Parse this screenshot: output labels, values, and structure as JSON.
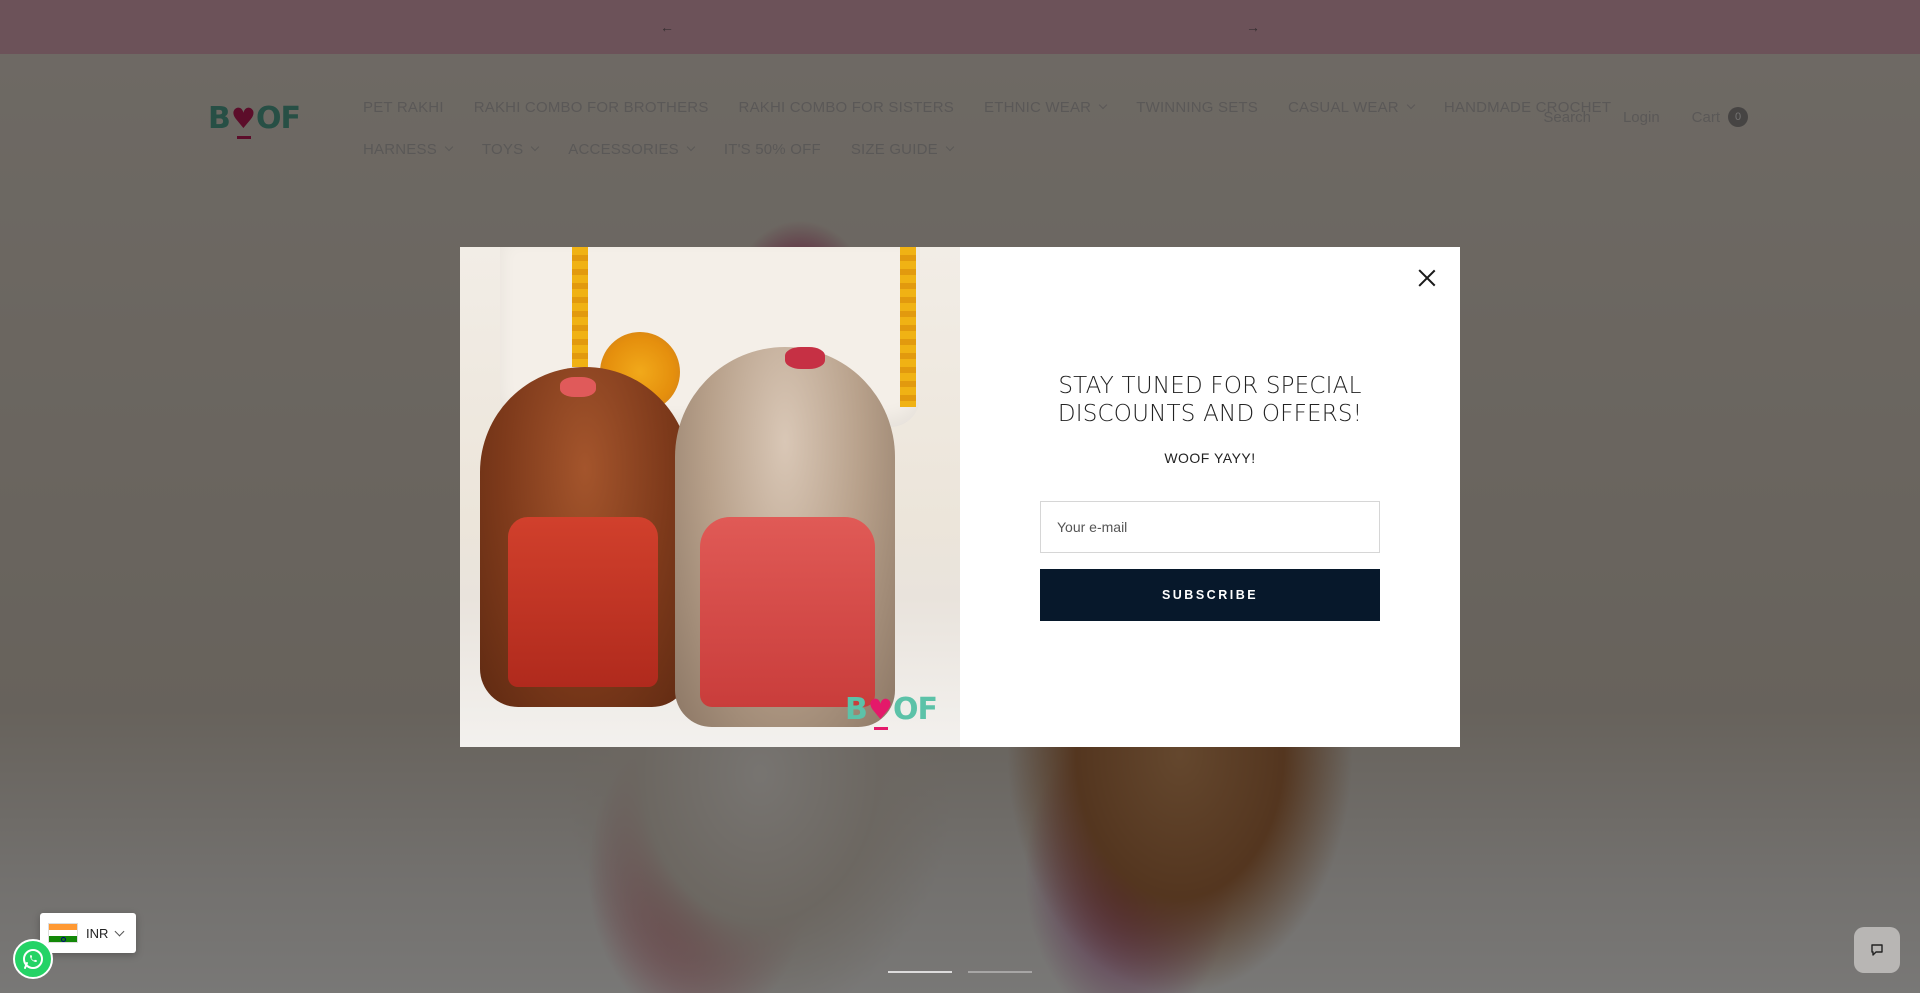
{
  "announcement": {
    "prev_icon": "arrow-left-icon",
    "next_icon": "arrow-right-icon"
  },
  "header": {
    "logo": {
      "part1": "B",
      "heart": "♥",
      "part2": "OF"
    },
    "nav_row1": [
      {
        "label": "PET RAKHI",
        "dropdown": false
      },
      {
        "label": "RAKHI COMBO FOR BROTHERS",
        "dropdown": false
      },
      {
        "label": "RAKHI COMBO FOR SISTERS",
        "dropdown": false
      },
      {
        "label": "ETHNIC WEAR",
        "dropdown": true
      },
      {
        "label": "TWINNING SETS",
        "dropdown": false
      },
      {
        "label": "CASUAL WEAR",
        "dropdown": true
      },
      {
        "label": "HANDMADE CROCHET",
        "dropdown": false
      }
    ],
    "nav_row2": [
      {
        "label": "HARNESS",
        "dropdown": true
      },
      {
        "label": "TOYS",
        "dropdown": true
      },
      {
        "label": "ACCESSORIES",
        "dropdown": true
      },
      {
        "label": "IT'S 50% OFF",
        "dropdown": false
      },
      {
        "label": "SIZE GUIDE",
        "dropdown": true
      }
    ],
    "search_label": "Search",
    "login_label": "Login",
    "cart_label": "Cart",
    "cart_count": "0"
  },
  "popup": {
    "title": "STAY TUNED FOR SPECIAL DISCOUNTS AND OFFERS!",
    "subtitle": "WOOF YAYY!",
    "email_placeholder": "Your e-mail",
    "subscribe_label": "SUBSCRIBE",
    "image_logo": {
      "part1": "B",
      "heart": "♥",
      "part2": "OF"
    }
  },
  "hero": {
    "slide_count": 2,
    "active_slide": 1
  },
  "currency": {
    "code": "INR",
    "flag": "india-flag-icon"
  },
  "colors": {
    "announcement_bg": "#d8a5b3",
    "subscribe_bg": "#07182b",
    "logo_teal": "#5cc2a8",
    "logo_pink": "#e4196a",
    "whatsapp_green": "#25d366"
  }
}
